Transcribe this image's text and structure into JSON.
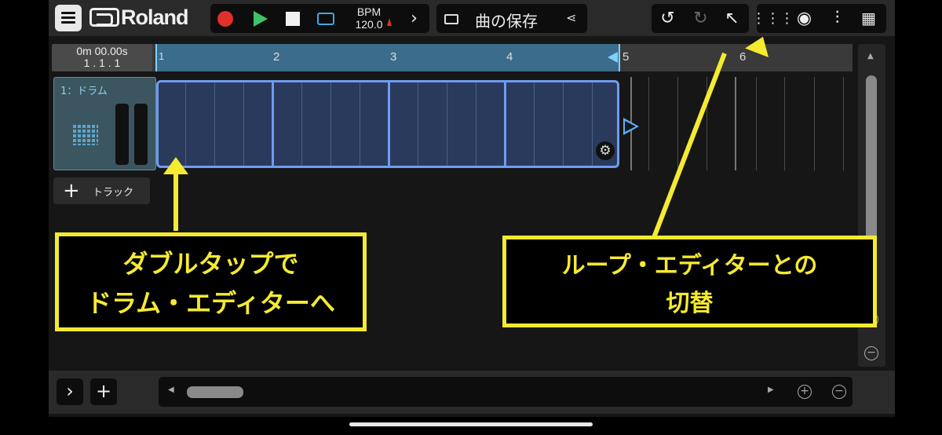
{
  "toolbar": {
    "brand": "Roland",
    "bpm_label": "BPM",
    "bpm_value": "120.0",
    "save_label": "曲の保存"
  },
  "ruler": {
    "time": "0m 00.00s",
    "position": "1 . 1 . 1",
    "bars": [
      "2",
      "3",
      "4",
      "5",
      "6"
    ],
    "bar_one_marker": "1"
  },
  "tracks": [
    {
      "name": "1：ドラム"
    }
  ],
  "add_track_label": "トラック",
  "annotations": {
    "drum_editor": [
      "ダブルタップで",
      "ドラム・エディターへ"
    ],
    "loop_editor": [
      "ループ・エディターとの",
      "切替"
    ],
    "color": "#f5ea30"
  },
  "colors": {
    "accent_blue": "#6f9bf0",
    "loop_region": "#3b6c8c",
    "record": "#e0302a",
    "play": "#3fc36a",
    "loop_icon": "#41a8e8"
  }
}
